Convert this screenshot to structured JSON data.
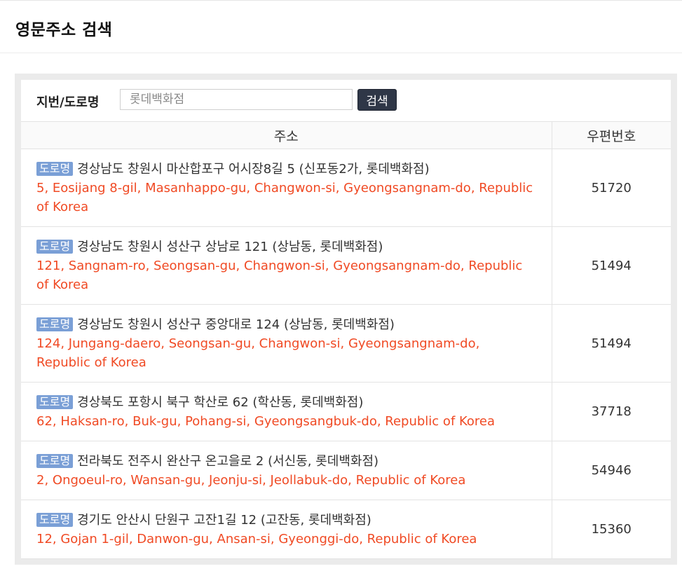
{
  "page": {
    "title": "영문주소 검색"
  },
  "search": {
    "label": "지번/도로명",
    "value": "",
    "placeholder": "롯데백화점",
    "button_label": "검색"
  },
  "table": {
    "columns": [
      "주소",
      "우편번호"
    ],
    "rows": [
      {
        "badge": "도로명",
        "korean": "경상남도 창원시 마산합포구 어시장8길 5 (신포동2가, 롯데백화점)",
        "english": "5, Eosijang 8-gil, Masanhappo-gu, Changwon-si, Gyeongsangnam-do, Republic of Korea",
        "zip": "51720"
      },
      {
        "badge": "도로명",
        "korean": "경상남도 창원시 성산구 상남로 121 (상남동, 롯데백화점)",
        "english": "121, Sangnam-ro, Seongsan-gu, Changwon-si, Gyeongsangnam-do, Republic of Korea",
        "zip": "51494"
      },
      {
        "badge": "도로명",
        "korean": "경상남도 창원시 성산구 중앙대로 124 (상남동, 롯데백화점)",
        "english": "124, Jungang-daero, Seongsan-gu, Changwon-si, Gyeongsangnam-do, Republic of Korea",
        "zip": "51494"
      },
      {
        "badge": "도로명",
        "korean": "경상북도 포항시 북구 학산로 62 (학산동, 롯데백화점)",
        "english": "62, Haksan-ro, Buk-gu, Pohang-si, Gyeongsangbuk-do, Republic of Korea",
        "zip": "37718"
      },
      {
        "badge": "도로명",
        "korean": "전라북도 전주시 완산구 온고을로 2 (서신동, 롯데백화점)",
        "english": "2, Ongoeul-ro, Wansan-gu, Jeonju-si, Jeollabuk-do, Republic of Korea",
        "zip": "54946"
      },
      {
        "badge": "도로명",
        "korean": "경기도 안산시 단원구 고잔1길 12 (고잔동, 롯데백화점)",
        "english": "12, Gojan 1-gil, Danwon-gu, Ansan-si, Gyeonggi-do, Republic of Korea",
        "zip": "15360"
      }
    ]
  },
  "colors": {
    "badge_bg": "#7a9fd6",
    "english_text": "#f04a24",
    "button_bg": "#2f3747",
    "panel_bg": "#ebebeb"
  }
}
